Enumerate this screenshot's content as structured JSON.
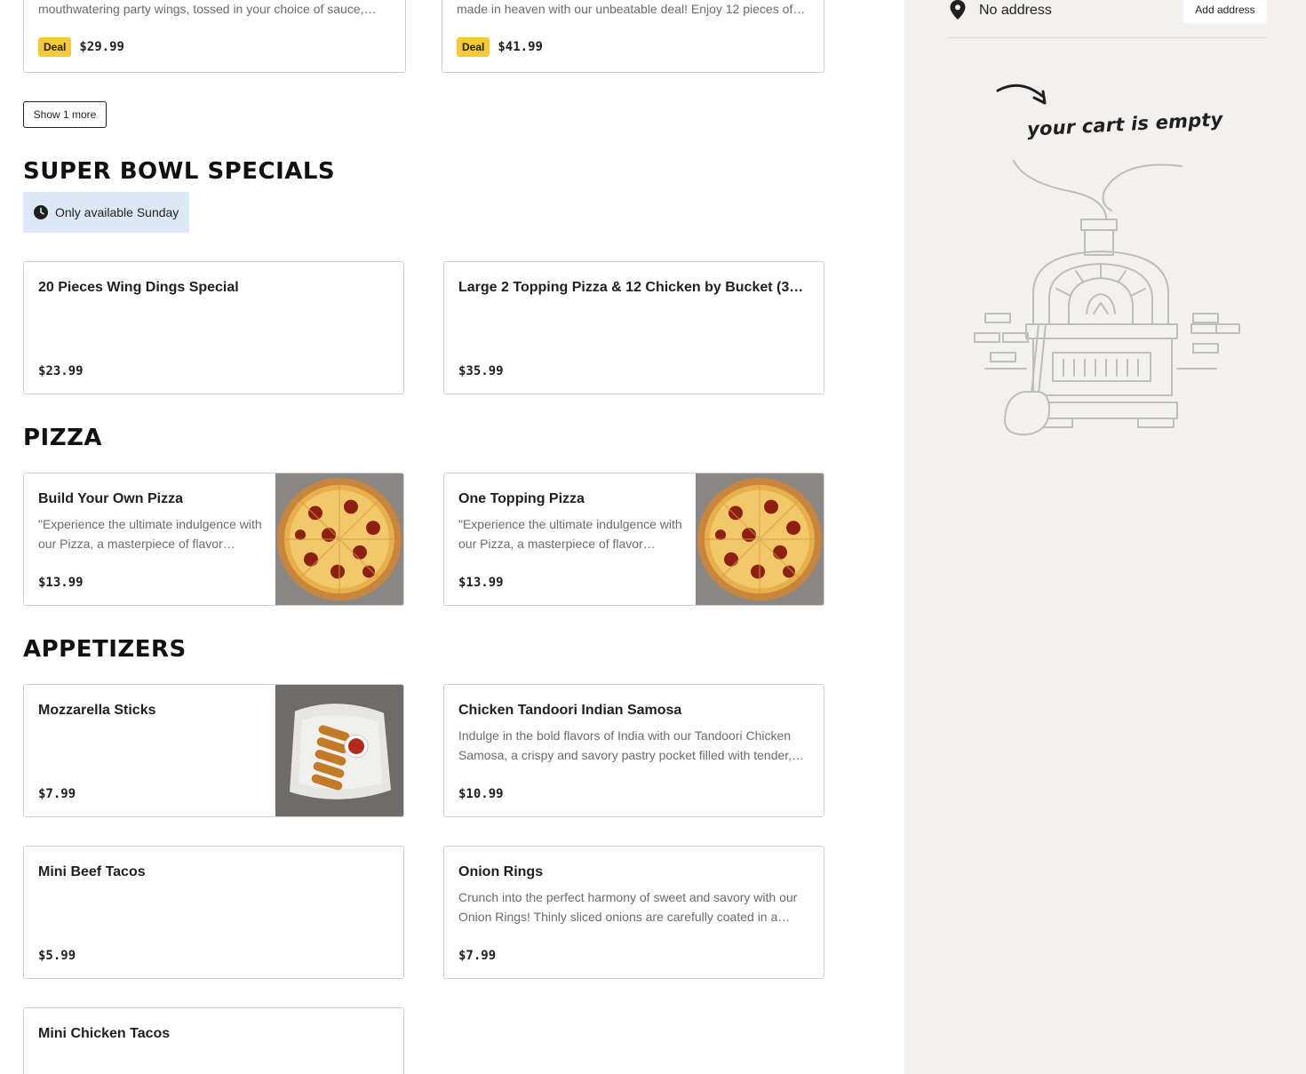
{
  "deals": [
    {
      "desc": "mouthwatering party wings, tossed in your choice of sauce,…",
      "badge": "Deal",
      "price": "$29.99"
    },
    {
      "desc": "made in heaven with our unbeatable deal! Enjoy 12 pieces of…",
      "badge": "Deal",
      "price": "$41.99"
    }
  ],
  "show_more_label": "Show 1 more",
  "sections": {
    "super_bowl": {
      "title": "SUPER BOWL SPECIALS",
      "availability": "Only available Sunday",
      "items": [
        {
          "title": "20 Pieces Wing Dings Special",
          "price": "$23.99"
        },
        {
          "title": "Large 2 Topping Pizza & 12 Chicken by Bucket (3…",
          "price": "$35.99"
        }
      ]
    },
    "pizza": {
      "title": "PIZZA",
      "items": [
        {
          "title": "Build Your Own Pizza",
          "desc": "\"Experience the ultimate indulgence with our Pizza, a masterpiece of flavor…",
          "price": "$13.99",
          "image": "pizza-photo"
        },
        {
          "title": "One Topping Pizza",
          "desc": "\"Experience the ultimate indulgence with our Pizza, a masterpiece of flavor…",
          "price": "$13.99",
          "image": "pizza-photo"
        }
      ]
    },
    "appetizers": {
      "title": "APPETIZERS",
      "items": [
        {
          "title": "Mozzarella Sticks",
          "price": "$7.99",
          "image": "mozzarella-sticks-photo"
        },
        {
          "title": "Chicken Tandoori Indian Samosa",
          "desc": "Indulge in the bold flavors of India with our Tandoori Chicken Samosa, a crispy and savory pastry pocket filled with tender,…",
          "price": "$10.99"
        },
        {
          "title": "Mini Beef Tacos",
          "price": "$5.99"
        },
        {
          "title": "Onion Rings",
          "desc": "Crunch into the perfect harmony of sweet and savory with our Onion Rings! Thinly sliced onions are carefully coated in a…",
          "price": "$7.99"
        },
        {
          "title": "Mini Chicken Tacos"
        }
      ]
    }
  },
  "cart": {
    "address": "No address",
    "add_address_label": "Add address",
    "empty_text": "your cart is empty",
    "illustration": "pizza-oven-illustration"
  },
  "colors": {
    "deal_badge": "#f7c934",
    "availability_bg": "#dde8f6",
    "sidebar_bg": "#f2f1ef",
    "card_border": "#cfcfcf"
  }
}
